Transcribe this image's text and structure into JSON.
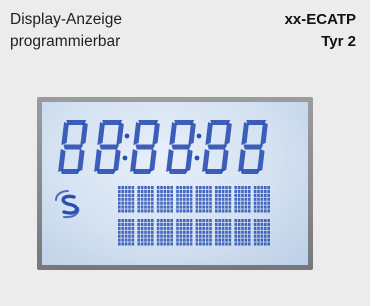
{
  "header": {
    "left_line1": "Display-Anzeige",
    "left_line2": "programmierbar",
    "right_line1": "xx-ECATP",
    "right_line2": "Tyr 2"
  },
  "display": {
    "digits": "888888",
    "digit_count": 6,
    "colon_positions": [
      2,
      4
    ],
    "matrix_rows": 2,
    "matrix_chars_per_row": 8,
    "segment_color": "#2a4fb2",
    "background_color": "#d9e6f3",
    "logo_icon": "s-logo-icon"
  }
}
